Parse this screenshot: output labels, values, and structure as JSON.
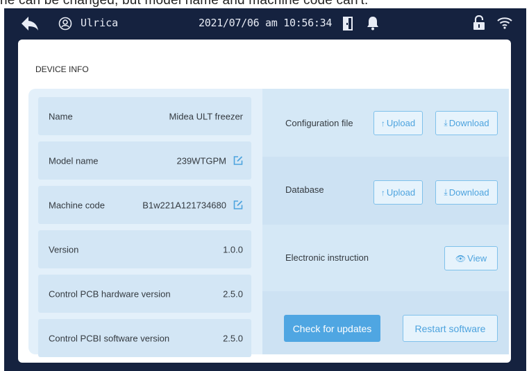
{
  "caption": "ne can be changed, but model name and machine code can't.",
  "status_bar": {
    "user_name": "Ulrica",
    "datetime": "2021/07/06 am 10:56:34",
    "icons": [
      "back-arrow-icon",
      "user-circle-icon",
      "door-icon",
      "bell-icon",
      "lock-icon",
      "wifi-icon"
    ]
  },
  "panel": {
    "title": "DEVICE INFO"
  },
  "device_info": [
    {
      "label": "Name",
      "value": "Midea ULT freezer",
      "editable": false
    },
    {
      "label": "Model name",
      "value": "239WTGPM",
      "editable": true
    },
    {
      "label": "Machine code",
      "value": "B1w221A121734680",
      "editable": true
    },
    {
      "label": "Version",
      "value": "1.0.0",
      "editable": false
    },
    {
      "label": "Control PCB hardware version",
      "value": "2.5.0",
      "editable": false
    },
    {
      "label": "Control PCBI software version",
      "value": "2.5.0",
      "editable": false
    }
  ],
  "actions": {
    "config_file": {
      "label": "Configuration file",
      "upload": "Upload",
      "download": "Download"
    },
    "database": {
      "label": "Database",
      "upload": "Upload",
      "download": "Download"
    },
    "instruction": {
      "label": "Electronic instruction",
      "view": "View"
    },
    "check_updates": "Check for updates",
    "restart": "Restart software"
  },
  "colors": {
    "frame": "#15223f",
    "accent": "#4fa6e2",
    "row_bg": "#d3e6f5",
    "area_bg": "#e3f0fa"
  }
}
